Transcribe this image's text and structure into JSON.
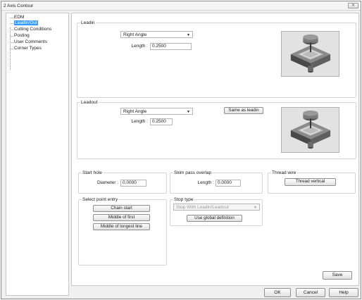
{
  "window": {
    "title": "2 Axis Contour",
    "close_glyph": "✕"
  },
  "tree": {
    "items": [
      {
        "label": "EDM"
      },
      {
        "label": "Leadin/Out"
      },
      {
        "label": "Cutting Conditions"
      },
      {
        "label": "Posting"
      },
      {
        "label": "User Comments"
      },
      {
        "label": "Corner Types"
      }
    ],
    "selected_index": 1
  },
  "leadin": {
    "group_label": "Leadin",
    "type_value": "Right Angle",
    "length_label": "Length :",
    "length_value": "0.2500"
  },
  "leadout": {
    "group_label": "Leadout",
    "type_value": "Right Angle",
    "same_as_leadin_label": "Same as leadin",
    "length_label": "Length :",
    "length_value": "0.2500"
  },
  "start_hole": {
    "group_label": "Start hole",
    "diameter_label": "Diameter :",
    "diameter_value": "0.0000"
  },
  "skim_pass": {
    "group_label": "Skim pass overlap",
    "length_label": "Length :",
    "length_value": "0.0000"
  },
  "thread_wire": {
    "group_label": "Thread wire",
    "button_label": "Thread vertical"
  },
  "select_point_entry": {
    "group_label": "Select point entry",
    "buttons": [
      "Chain start",
      "Middle of first",
      "Middle of longest line"
    ]
  },
  "stop_type": {
    "group_label": "Stop type",
    "value": "Stop With Leadin/Leadout",
    "global_button_label": "Use global definition"
  },
  "actions": {
    "save_label": "Save",
    "ok_label": "OK",
    "cancel_label": "Cancel",
    "help_label": "Help"
  },
  "icons": {
    "dropdown": "▼"
  },
  "colors": {
    "selection": "#3399ff",
    "part_top": "#6a6a6a",
    "part_side": "#4a4a4a"
  }
}
